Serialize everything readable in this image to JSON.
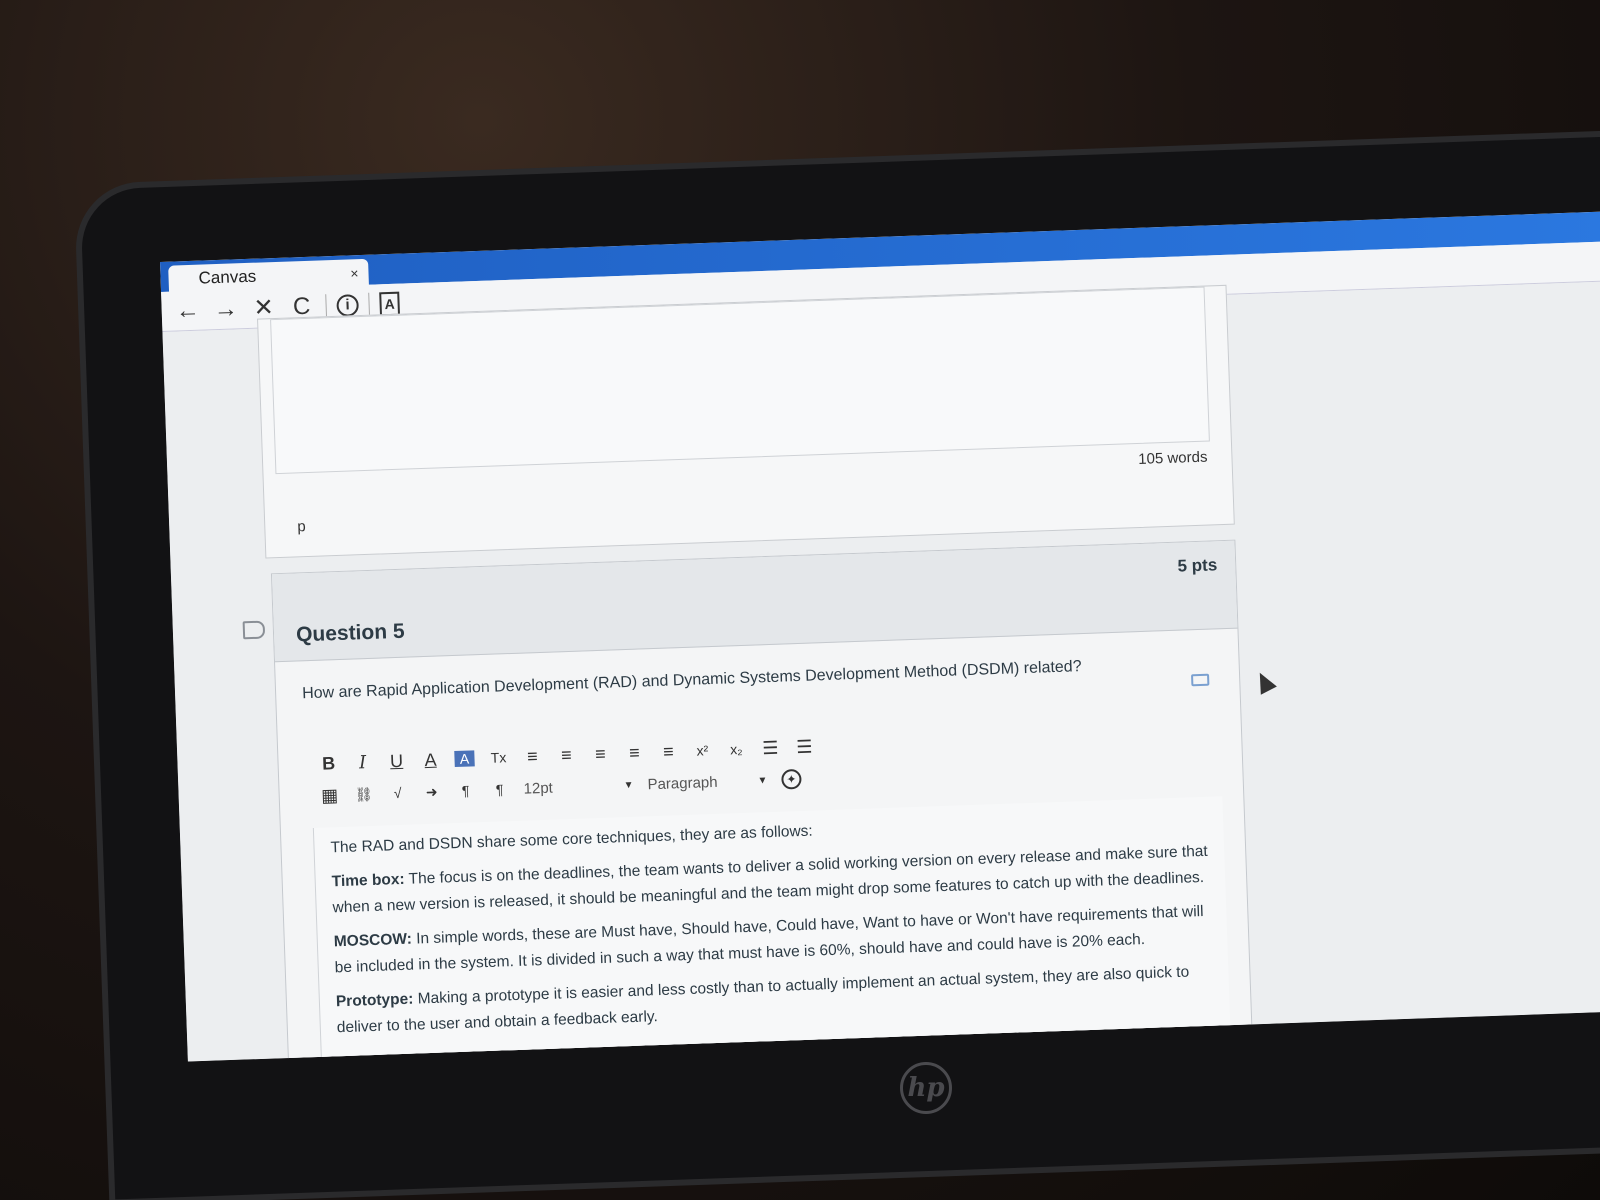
{
  "browser": {
    "tab_title": "Canvas",
    "tab_close": "×",
    "nav": {
      "back": "←",
      "forward": "→",
      "stop": "✕",
      "reload": "C",
      "info": "i",
      "doc": "A"
    }
  },
  "previous_answer": {
    "word_count": "105 words",
    "path_label": "p"
  },
  "question": {
    "title": "Question 5",
    "points": "5 pts",
    "prompt": "How are Rapid Application Development (RAD) and Dynamic Systems Development Method (DSDM) related?"
  },
  "editor": {
    "toolbar_row1": [
      "B",
      "I",
      "U",
      "A",
      "A",
      "Tx",
      "≡",
      "≡",
      "≡",
      "≡",
      "≡",
      "x²",
      "x₂",
      "☰",
      "☰"
    ],
    "font_size": "12pt",
    "block_format": "Paragraph"
  },
  "answer": {
    "intro": "The RAD and DSDN share some core techniques, they are as follows:",
    "timebox_label": "Time box:",
    "timebox_text": " The focus is on the deadlines,  the team wants to deliver a solid working version on every release and make sure that when a new version is released, it should be meaningful and the team might drop some features to catch up with the deadlines.",
    "moscow_label": "MOSCOW:",
    "moscow_text": "  In simple words, these are Must have, Should have, Could have, Want to have or Won't have requirements that will be included in the system. It is divided in such a way that must have is 60%, should have and could have is 20% each.",
    "prototype_label": "Prototype:",
    "prototype_text": " Making a prototype it is easier and less costly than to actually implement an actual system, they are also quick to deliver to the user and obtain a feedback early."
  },
  "device": {
    "logo_text": "hp"
  },
  "colors": {
    "titlebar": "#2b78e0",
    "text": "#2d3b45"
  }
}
